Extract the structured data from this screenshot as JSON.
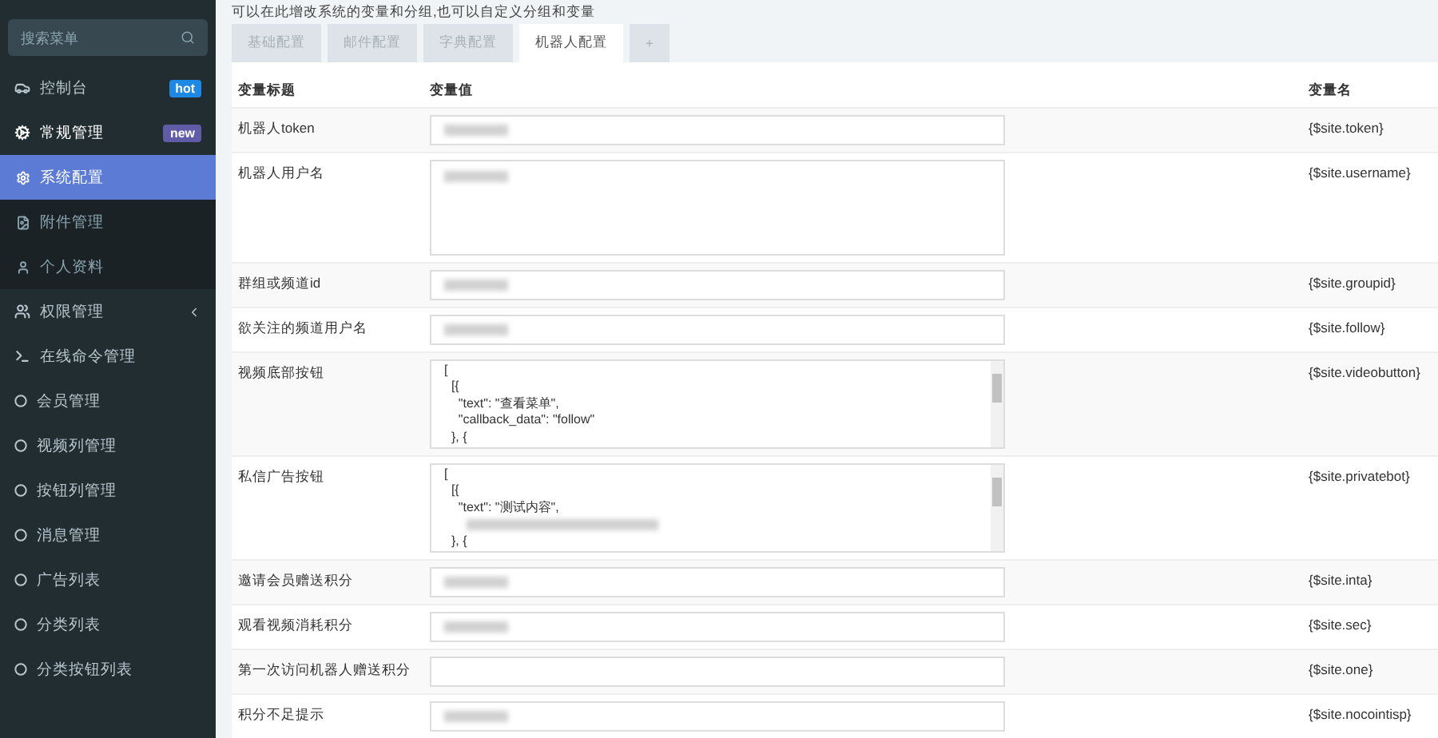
{
  "sidebar": {
    "search": {
      "placeholder": "搜索菜单"
    },
    "items": [
      {
        "label": "控制台",
        "badge": {
          "text": "hot",
          "color": "#1e88e5"
        },
        "selected": false
      },
      {
        "label": "常规管理",
        "badge": {
          "text": "new",
          "color": "#605ca8"
        },
        "selected": false,
        "expanded": true,
        "children": [
          {
            "label": "系统配置",
            "selected": true
          },
          {
            "label": "附件管理",
            "selected": false
          },
          {
            "label": "个人资料",
            "selected": false
          }
        ]
      },
      {
        "label": "权限管理",
        "selected": false,
        "expanded": false
      },
      {
        "label": "在线命令管理",
        "selected": false
      },
      {
        "label": "会员管理",
        "selected": false
      },
      {
        "label": "视频列管理",
        "selected": false
      },
      {
        "label": "按钮列管理",
        "selected": false
      },
      {
        "label": "消息管理",
        "selected": false
      },
      {
        "label": "广告列表",
        "selected": false
      },
      {
        "label": "分类列表",
        "selected": false
      },
      {
        "label": "分类按钮列表",
        "selected": false
      }
    ]
  },
  "intro": "可以在此增改系统的变量和分组,也可以自定义分组和变量",
  "tabs": [
    {
      "label": "基础配置",
      "selected": false
    },
    {
      "label": "邮件配置",
      "selected": false
    },
    {
      "label": "字典配置",
      "selected": false
    },
    {
      "label": "机器人配置",
      "selected": true
    },
    {
      "label": "+",
      "selected": false
    }
  ],
  "table": {
    "columns": [
      "变量标题",
      "变量值",
      "变量名"
    ],
    "rows": [
      {
        "title": "机器人token",
        "kind": "input",
        "blurred": true,
        "variable": "{$site.token}"
      },
      {
        "title": "机器人用户名",
        "kind": "textarea",
        "blurred": true,
        "variable": "{$site.username}"
      },
      {
        "title": "群组或频道id",
        "kind": "input",
        "blurred": true,
        "variable": "{$site.groupid}"
      },
      {
        "title": "欲关注的频道用户名",
        "kind": "input",
        "blurred": true,
        "variable": "{$site.follow}"
      },
      {
        "title": "视频底部按钮",
        "kind": "code",
        "lines": [
          {
            "kind": "text",
            "text": "["
          },
          {
            "kind": "text",
            "text": "  [{"
          },
          {
            "kind": "text",
            "text": "    \"text\": \"查看菜单\","
          },
          {
            "kind": "text",
            "text": "    \"callback_data\": \"follow\""
          },
          {
            "kind": "text",
            "text": "  }, {"
          }
        ],
        "variable": "{$site.videobutton}"
      },
      {
        "title": "私信广告按钮",
        "kind": "code",
        "lines": [
          {
            "kind": "text",
            "text": "["
          },
          {
            "kind": "text",
            "text": "  [{"
          },
          {
            "kind": "text",
            "text": "    \"text\": \"测试内容\","
          },
          {
            "kind": "blurred"
          },
          {
            "kind": "text",
            "text": "  }, {"
          }
        ],
        "variable": "{$site.privatebot}"
      },
      {
        "title": "邀请会员赠送积分",
        "kind": "input",
        "blurred": true,
        "variable": "{$site.inta}"
      },
      {
        "title": "观看视频消耗积分",
        "kind": "input",
        "blurred": true,
        "variable": "{$site.sec}"
      },
      {
        "title": "第一次访问机器人赠送积分",
        "kind": "input",
        "blurred": false,
        "variable": "{$site.one}"
      },
      {
        "title": "积分不足提示",
        "kind": "input",
        "blurred": true,
        "variable": "{$site.nocointisp}"
      }
    ]
  }
}
